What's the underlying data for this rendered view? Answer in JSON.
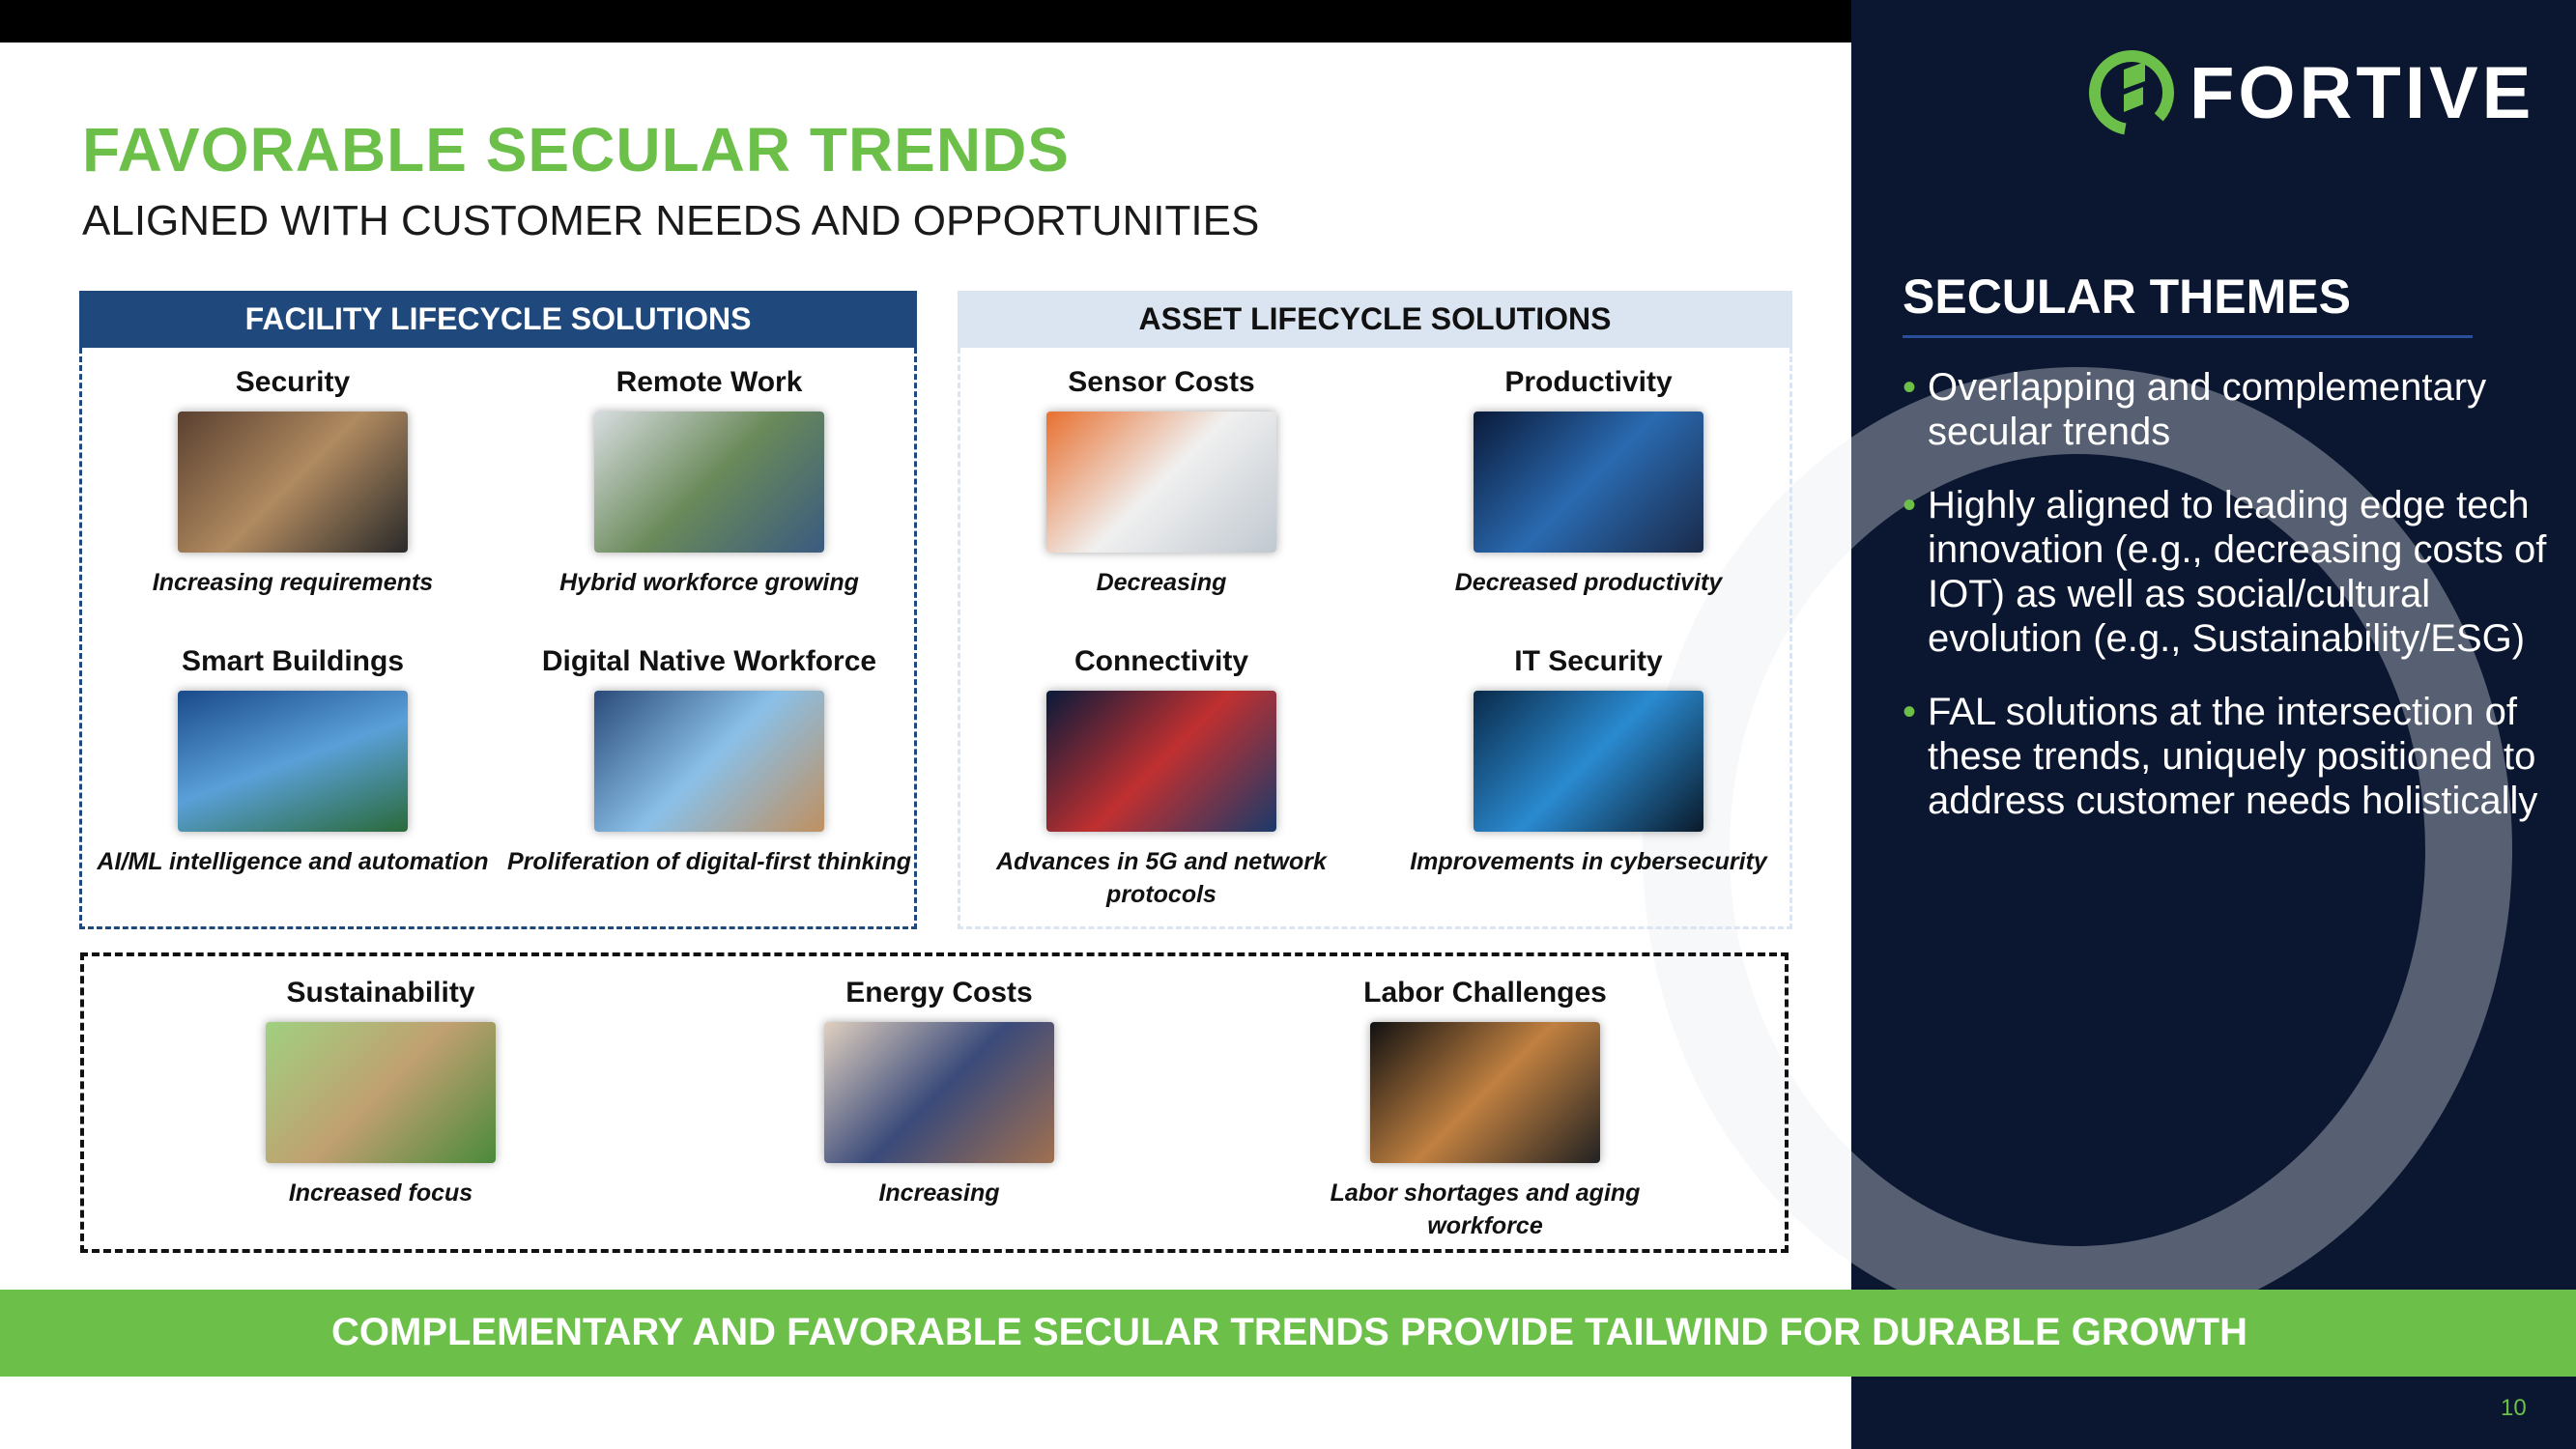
{
  "header": {
    "title": "FAVORABLE SECULAR TRENDS",
    "subtitle": "ALIGNED WITH CUSTOMER NEEDS AND OPPORTUNITIES"
  },
  "brand": {
    "name": "FORTIVE",
    "color": "#6cc04a"
  },
  "facility": {
    "title": "FACILITY LIFECYCLE SOLUTIONS",
    "items": [
      {
        "title": "Security",
        "caption": "Increasing requirements"
      },
      {
        "title": "Remote Work",
        "caption": "Hybrid workforce growing"
      },
      {
        "title": "Smart Buildings",
        "caption": "AI/ML intelligence and automation"
      },
      {
        "title": "Digital Native Workforce",
        "caption": "Proliferation of digital-first thinking"
      }
    ]
  },
  "asset": {
    "title": "ASSET LIFECYCLE SOLUTIONS",
    "items": [
      {
        "title": "Sensor Costs",
        "caption": "Decreasing"
      },
      {
        "title": "Productivity",
        "caption": "Decreased productivity"
      },
      {
        "title": "Connectivity",
        "caption": "Advances in 5G and network protocols"
      },
      {
        "title": "IT Security",
        "caption": "Improvements in cybersecurity"
      }
    ]
  },
  "shared": {
    "items": [
      {
        "title": "Sustainability",
        "caption": "Increased focus"
      },
      {
        "title": "Energy Costs",
        "caption": "Increasing"
      },
      {
        "title": "Labor Challenges",
        "caption": "Labor shortages and aging workforce"
      }
    ]
  },
  "themes": {
    "title": "SECULAR THEMES",
    "bullets": [
      "Overlapping and complementary secular trends",
      "Highly aligned to leading edge tech innovation (e.g., decreasing costs of IOT) as well as social/cultural evolution (e.g., Sustainability/ESG)",
      "FAL solutions at the intersection of these trends, uniquely positioned to address customer needs holistically"
    ]
  },
  "footer": {
    "banner": "COMPLEMENTARY AND FAVORABLE SECULAR TRENDS PROVIDE TAILWIND FOR DURABLE GROWTH",
    "page": "10"
  }
}
